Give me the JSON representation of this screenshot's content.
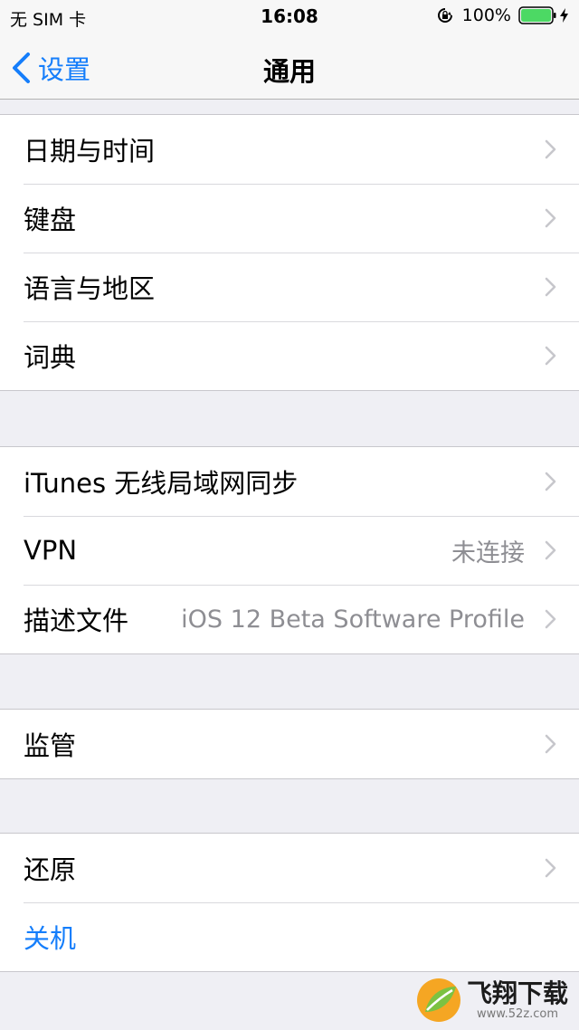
{
  "status_bar": {
    "carrier": "无 SIM 卡",
    "time": "16:08",
    "battery": "100%"
  },
  "nav": {
    "back_label": "设置",
    "title": "通用"
  },
  "groups": [
    {
      "rows": [
        {
          "label": "日期与时间"
        },
        {
          "label": "键盘"
        },
        {
          "label": "语言与地区"
        },
        {
          "label": "词典"
        }
      ]
    },
    {
      "rows": [
        {
          "label": "iTunes 无线局域网同步"
        },
        {
          "label": "VPN",
          "value": "未连接"
        },
        {
          "label": "描述文件",
          "value": "iOS 12 Beta Software Profile"
        }
      ]
    },
    {
      "rows": [
        {
          "label": "监管"
        }
      ]
    },
    {
      "rows": [
        {
          "label": "还原"
        },
        {
          "label": "关机"
        }
      ]
    }
  ],
  "watermark": {
    "title": "飞翔下载",
    "url": "www.52z.com"
  },
  "colors": {
    "accent": "#157efb",
    "battery": "#4cd964",
    "background": "#efeff4"
  }
}
